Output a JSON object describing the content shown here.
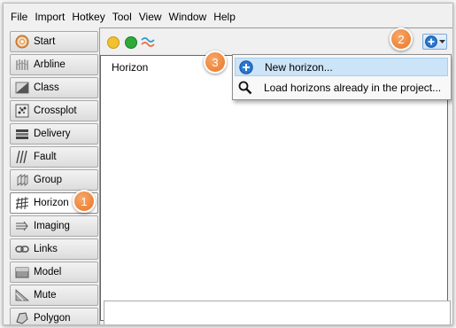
{
  "menubar": {
    "items": [
      "File",
      "Import",
      "Hotkey",
      "Tool",
      "View",
      "Window",
      "Help"
    ]
  },
  "sidebar": {
    "items": [
      {
        "label": "Start",
        "icon": "start-icon"
      },
      {
        "label": "Arbline",
        "icon": "arbline-icon"
      },
      {
        "label": "Class",
        "icon": "class-icon"
      },
      {
        "label": "Crossplot",
        "icon": "crossplot-icon"
      },
      {
        "label": "Delivery",
        "icon": "delivery-icon"
      },
      {
        "label": "Fault",
        "icon": "fault-icon"
      },
      {
        "label": "Group",
        "icon": "group-icon"
      },
      {
        "label": "Horizon",
        "icon": "horizon-icon",
        "active": true
      },
      {
        "label": "Imaging",
        "icon": "imaging-icon"
      },
      {
        "label": "Links",
        "icon": "links-icon"
      },
      {
        "label": "Model",
        "icon": "model-icon"
      },
      {
        "label": "Mute",
        "icon": "mute-icon"
      },
      {
        "label": "Polygon",
        "icon": "polygon-icon"
      }
    ]
  },
  "panel": {
    "list_header": "Horizon"
  },
  "dropdown": {
    "items": [
      {
        "label": "New horizon...",
        "icon": "plus-circle-icon",
        "highlighted": true
      },
      {
        "label": "Load horizons already in the project...",
        "icon": "magnifier-icon"
      }
    ]
  },
  "callouts": [
    "1",
    "2",
    "3"
  ],
  "colors": {
    "accent": "#2a78d2",
    "callout": "#ea7424",
    "highlight": "#cce4f7"
  }
}
